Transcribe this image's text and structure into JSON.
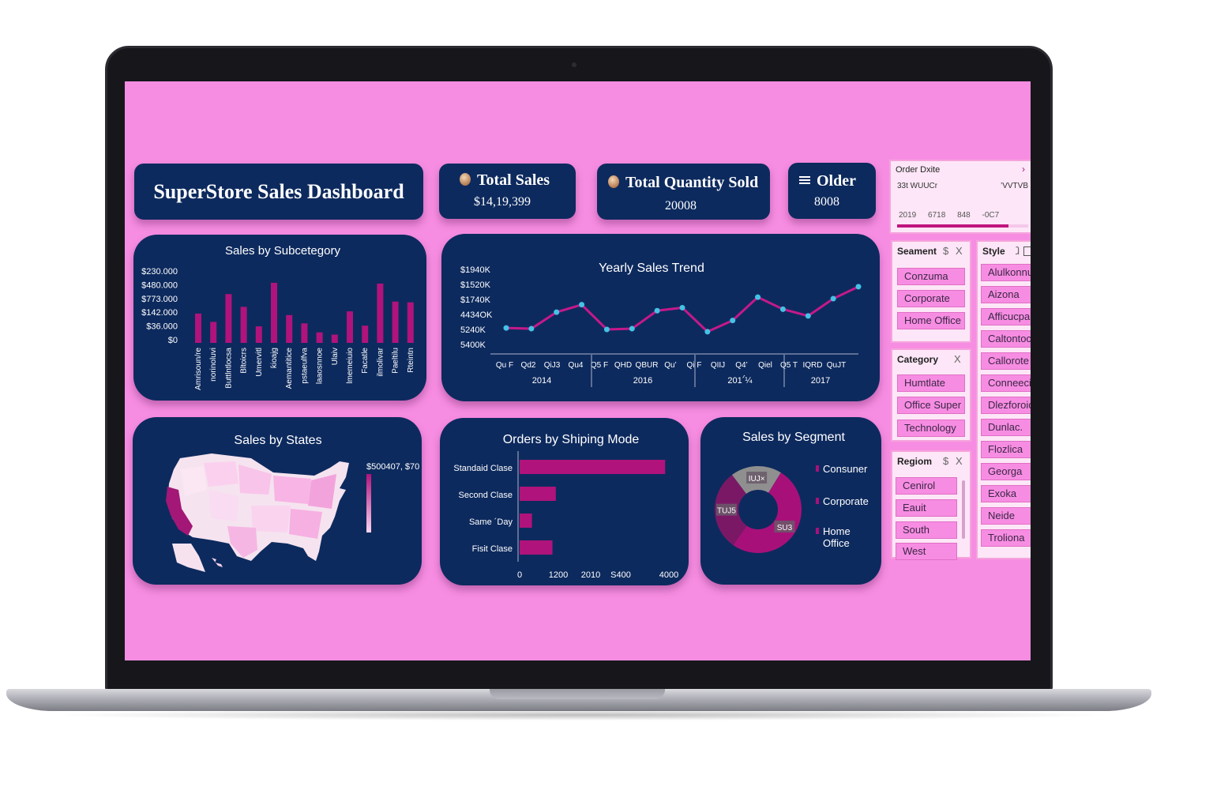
{
  "dashboard": {
    "title": "SuperStore Sales Dashboard"
  },
  "kpis": {
    "total_sales": {
      "label": "Total Sales",
      "value": "$14,19,399"
    },
    "total_quantity": {
      "label": "Total Quantity Sold",
      "value": "20008"
    },
    "orders": {
      "label": "Older",
      "value": "8008"
    }
  },
  "order_date": {
    "label": "Order Dxite",
    "chevron": "›",
    "left_text": "33t WUUCr",
    "right_text": "’VVTVB",
    "values": [
      "2019",
      "6718",
      "848",
      "-0C7"
    ],
    "range_fraction": 0.85
  },
  "segment_slicer": {
    "label": "Seament",
    "ctrl": "$",
    "clear": "X",
    "items": [
      "Conzuma",
      "Corporate",
      "Home Office"
    ]
  },
  "category_slicer": {
    "label": "Category",
    "clear": "X",
    "items": [
      "Humtlate",
      "Office Super",
      "Technology"
    ]
  },
  "region_slicer": {
    "label": "Regiom",
    "ctrl": "$",
    "clear": "X",
    "items": [
      "Cenirol",
      "Eauit",
      "South",
      "West"
    ]
  },
  "style_slicer": {
    "label": "Style",
    "ctrl": "ⱹ",
    "items": [
      "Alulkonnu",
      "Aizona",
      "Afficucpa",
      "Caltontoc",
      "Callorote",
      "Conneeci",
      "Dlezforoio",
      "Dunlac.",
      "Flozlica",
      "Georga",
      "Exoka",
      "Neide",
      "Troliona"
    ]
  },
  "colors": {
    "pink_bg": "#f78de2",
    "navy": "#0d2a5e",
    "magenta": "#b0137b",
    "cyan_point": "#43c3e6"
  },
  "chart_data": [
    {
      "type": "bar",
      "title": "Sales by Subcetegory",
      "y_tick_labels": [
        "$230.000",
        "$480.000",
        "$773.000",
        "$142.000",
        "$36.000",
        "$0"
      ],
      "categories": [
        "Anceasuries",
        "Appliances",
        "Brticholdnys",
        "Binders",
        "Bookcases",
        "Chairs",
        "Copiers",
        "Envelopes",
        "Fasteners",
        "Furnishings",
        "Labels",
        "Machines",
        "Paper",
        "Phones",
        "Storage"
      ],
      "category_labels": [
        "Amrisoun/re",
        "norinoluvi",
        "Buttlntlocsa",
        "Bltoicrs",
        "Umervitl",
        "ƙioajg",
        "Aemantitice",
        "pstaeulfva",
        "laaosnnoe",
        "Ulaiv",
        "lmemeiuio",
        "Facatle",
        "ilmolivar",
        "Paeltilu",
        "Rteintn"
      ],
      "values": [
        39,
        28,
        65,
        48,
        22,
        80,
        37,
        26,
        14,
        11,
        42,
        23,
        79,
        55,
        54
      ],
      "ylim": [
        0,
        100
      ],
      "bar_color": "#b0137b"
    },
    {
      "type": "line",
      "title": "Yearly Sales Trend",
      "y_tick_labels": [
        "$1940K",
        "$1520K",
        "$1740K",
        "4434OK",
        "5240K",
        "5400K"
      ],
      "x_tick_labels": [
        "Qu F",
        "Qd2",
        "QiJ3",
        "Qu4",
        "Q5 F",
        "QHD",
        "QBUR",
        "Qu’",
        "Qi F",
        "QIIJ",
        "Q4’",
        "Qiel",
        "Q5 T",
        "IQRD",
        "QuJT"
      ],
      "years": [
        "2014",
        "2016",
        "201´́¼",
        "2017"
      ],
      "values": [
        22,
        21,
        43,
        53,
        20,
        21,
        45,
        49,
        17,
        32,
        63,
        47,
        38,
        61,
        77
      ],
      "ylim": [
        0,
        100
      ],
      "line_color": "#c4198a",
      "point_color": "#43c3e6"
    },
    {
      "type": "choropleth",
      "title": "Sales by States",
      "legend_max": "$500407, $70",
      "highlight": "California"
    },
    {
      "type": "bar",
      "orientation": "horizontal",
      "title": "Orders by Shiping Mode",
      "categories": [
        "Standaid Clase",
        "Second Clase",
        "Same ´Day",
        "Fisit Clase"
      ],
      "values": [
        3900,
        970,
        330,
        880
      ],
      "x_tick_labels": [
        "0",
        "1200",
        "2010",
        "S400",
        "4000"
      ],
      "xlim": [
        0,
        4000
      ],
      "bar_color": "#b0137b"
    },
    {
      "type": "pie",
      "title": "Sales by Segment",
      "donut": true,
      "labels": [
        "Consuner",
        "Corporate",
        "Home Office"
      ],
      "values": [
        51,
        30,
        19
      ],
      "slice_labels": [
        "SU3",
        "TUJ5",
        "IUJ×"
      ],
      "colors": [
        "#a81079",
        "#7b1866",
        "#8f8f8f"
      ]
    }
  ]
}
